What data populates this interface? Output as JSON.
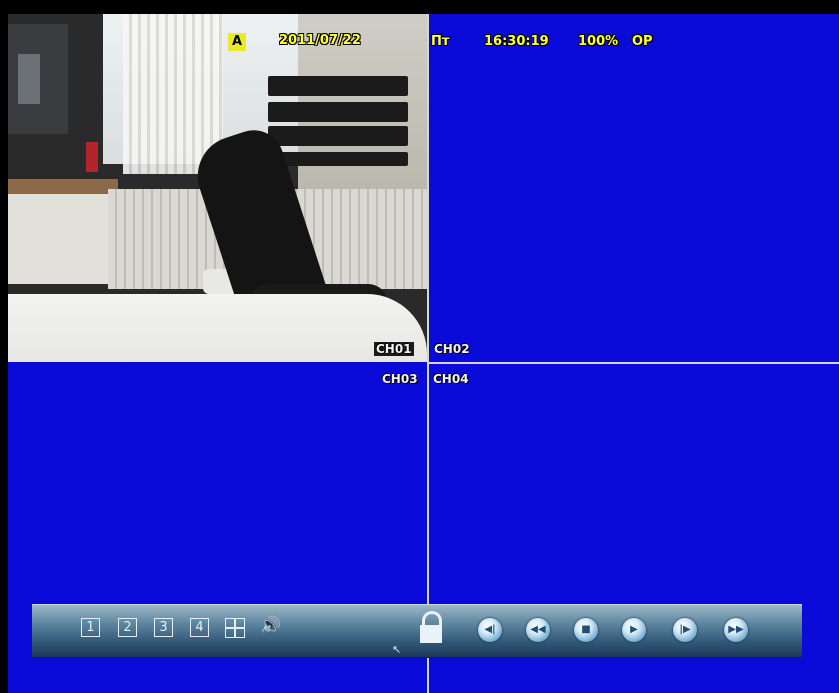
{
  "osd": {
    "alarm_badge": "A",
    "date": "2011/07/22",
    "day": "Пт",
    "time": "16:30:19",
    "percent": "100%",
    "mode": "OP"
  },
  "channels": [
    {
      "label": "CH01"
    },
    {
      "label": "CH02"
    },
    {
      "label": "CH03"
    },
    {
      "label": "CH04"
    }
  ],
  "toolbar": {
    "channel_buttons": [
      "1",
      "2",
      "3",
      "4"
    ],
    "icons": [
      "quad-view-icon",
      "volume-icon",
      "lock-icon",
      "rewind-slow-icon",
      "fast-rewind-icon",
      "stop-icon",
      "play-icon",
      "step-forward-icon",
      "fast-forward-icon"
    ]
  },
  "colors": {
    "screen_blue": "#0a0bd8",
    "osd_yellow": "#ffff3a"
  }
}
